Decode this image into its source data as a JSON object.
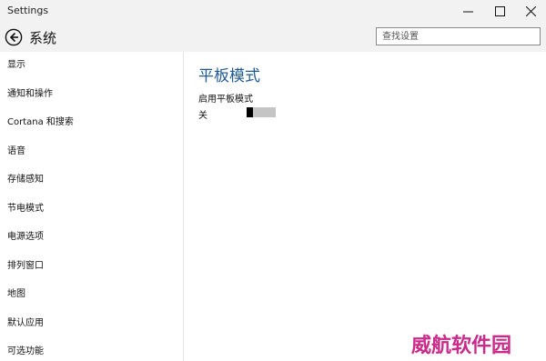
{
  "window": {
    "title": "Settings"
  },
  "header": {
    "title": "系统",
    "search_placeholder": "查找设置"
  },
  "sidebar": {
    "items": [
      {
        "label": "显示"
      },
      {
        "label": "通知和操作"
      },
      {
        "label": "Cortana 和搜索"
      },
      {
        "label": "语音"
      },
      {
        "label": "存储感知"
      },
      {
        "label": "节电模式"
      },
      {
        "label": "电源选项"
      },
      {
        "label": "排列窗口"
      },
      {
        "label": "地图"
      },
      {
        "label": "默认应用"
      },
      {
        "label": "可选功能"
      }
    ]
  },
  "main": {
    "heading": "平板模式",
    "setting": {
      "label": "启用平板模式",
      "state_text": "关",
      "on": false
    }
  },
  "watermark": "威航软件园",
  "colors": {
    "accent": "#1f5a95",
    "watermark": "#cc2a8a",
    "chrome": "#f2f2f2"
  }
}
